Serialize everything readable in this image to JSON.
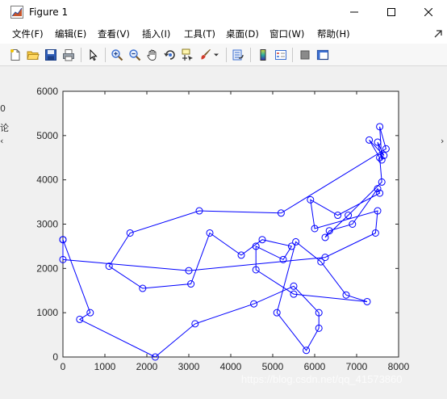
{
  "window": {
    "title": "Figure 1"
  },
  "menu": {
    "items": [
      "文件(F)",
      "编辑(E)",
      "查看(V)",
      "插入(I)",
      "工具(T)",
      "桌面(D)",
      "窗口(W)",
      "帮助(H)"
    ]
  },
  "toolbar": {
    "buttons": [
      "new-figure-icon",
      "open-file-icon",
      "save-icon",
      "print-icon",
      "arrow-icon",
      "zoom-in-icon",
      "zoom-out-icon",
      "pan-icon",
      "rotate-3d-icon",
      "data-cursor-icon",
      "brush-icon",
      "brush-dropdown-icon",
      "link-plot-icon",
      "colorbar-icon",
      "legend-icon",
      "hide-plot-tools-icon",
      "show-plot-tools-icon"
    ]
  },
  "bleed": {
    "left_top": "0",
    "left_mid": "论",
    "left_arrow": "‹",
    "right_arrow": "›"
  },
  "watermark": "https://blog.csdn.net/qq_41573860",
  "chart_data": {
    "type": "line",
    "marker": "circle",
    "line_color": "#0000ff",
    "xlim": [
      0,
      8000
    ],
    "ylim": [
      0,
      6000
    ],
    "xticks": [
      "0",
      "1000",
      "2000",
      "3000",
      "4000",
      "5000",
      "6000",
      "7000",
      "8000"
    ],
    "yticks": [
      "0",
      "1000",
      "2000",
      "3000",
      "4000",
      "5000",
      "6000"
    ],
    "grid": false,
    "title": "",
    "xlabel": "",
    "ylabel": "",
    "x": [
      0,
      650,
      400,
      2200,
      3150,
      4550,
      5500,
      6100,
      6100,
      5800,
      5100,
      5550,
      6150,
      6750,
      7250,
      5500,
      4600,
      4600,
      5250,
      5450,
      4750,
      4250,
      3500,
      3050,
      1900,
      1100,
      1600,
      3250,
      5200,
      7700,
      7550,
      7600,
      7500,
      7650,
      7300,
      7550,
      7600,
      6800,
      6250,
      6350,
      6900,
      7500,
      7550,
      6550,
      5900,
      6000,
      7500,
      7450,
      6250,
      3000,
      0,
      0
    ],
    "y": [
      2650,
      1000,
      850,
      0,
      750,
      1200,
      1600,
      1000,
      650,
      150,
      1000,
      2600,
      2150,
      1400,
      1250,
      1420,
      1970,
      2500,
      2200,
      2500,
      2650,
      2300,
      2800,
      1650,
      1550,
      2050,
      2800,
      3300,
      3250,
      4700,
      5200,
      4450,
      4850,
      4550,
      4900,
      4500,
      3950,
      3200,
      2700,
      2850,
      3000,
      3800,
      3700,
      3200,
      3550,
      2900,
      3300,
      2800,
      2250,
      1950,
      2200,
      2650
    ]
  }
}
